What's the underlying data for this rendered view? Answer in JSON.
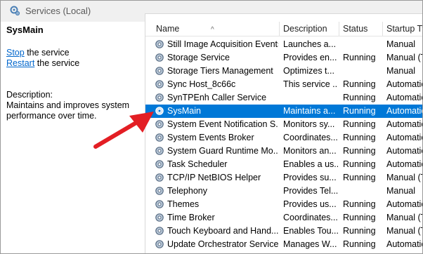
{
  "window": {
    "title": "Services (Local)"
  },
  "left_pane": {
    "service_name": "SysMain",
    "stop_link": "Stop",
    "stop_suffix": " the service",
    "restart_link": "Restart",
    "restart_suffix": " the service",
    "description_label": "Description:",
    "description_text": "Maintains and improves system performance over time."
  },
  "table": {
    "columns": [
      "Name",
      "Description",
      "Status",
      "Startup Type"
    ],
    "sort_indicator": "^",
    "selected_index": 6,
    "rows": [
      {
        "name": "Still Image Acquisition Events",
        "description": "Launches a...",
        "status": "",
        "startup": "Manual"
      },
      {
        "name": "Storage Service",
        "description": "Provides en...",
        "status": "Running",
        "startup": "Manual (Tri"
      },
      {
        "name": "Storage Tiers Management",
        "description": "Optimizes t...",
        "status": "",
        "startup": "Manual"
      },
      {
        "name": "Sync Host_8c66c",
        "description": "This service ...",
        "status": "Running",
        "startup": "Automatic"
      },
      {
        "name": "SynTPEnh Caller Service",
        "description": "",
        "status": "Running",
        "startup": "Automatic"
      },
      {
        "name": "SysMain",
        "description": "Maintains a...",
        "status": "Running",
        "startup": "Automatic"
      },
      {
        "name": "System Event Notification S...",
        "description": "Monitors sy...",
        "status": "Running",
        "startup": "Automatic"
      },
      {
        "name": "System Events Broker",
        "description": "Coordinates...",
        "status": "Running",
        "startup": "Automatic"
      },
      {
        "name": "System Guard Runtime Mo...",
        "description": "Monitors an...",
        "status": "Running",
        "startup": "Automatic"
      },
      {
        "name": "Task Scheduler",
        "description": "Enables a us...",
        "status": "Running",
        "startup": "Automatic"
      },
      {
        "name": "TCP/IP NetBIOS Helper",
        "description": "Provides su...",
        "status": "Running",
        "startup": "Manual (Tri"
      },
      {
        "name": "Telephony",
        "description": "Provides Tel...",
        "status": "",
        "startup": "Manual"
      },
      {
        "name": "Themes",
        "description": "Provides us...",
        "status": "Running",
        "startup": "Automatic"
      },
      {
        "name": "Time Broker",
        "description": "Coordinates...",
        "status": "Running",
        "startup": "Manual (Tri"
      },
      {
        "name": "Touch Keyboard and Hand...",
        "description": "Enables Tou...",
        "status": "Running",
        "startup": "Manual (Tri"
      },
      {
        "name": "Update Orchestrator Service",
        "description": "Manages W...",
        "status": "Running",
        "startup": "Automatic"
      }
    ]
  },
  "colors": {
    "selection": "#0078d7",
    "link": "#0066cc",
    "arrow": "#e31e24"
  }
}
